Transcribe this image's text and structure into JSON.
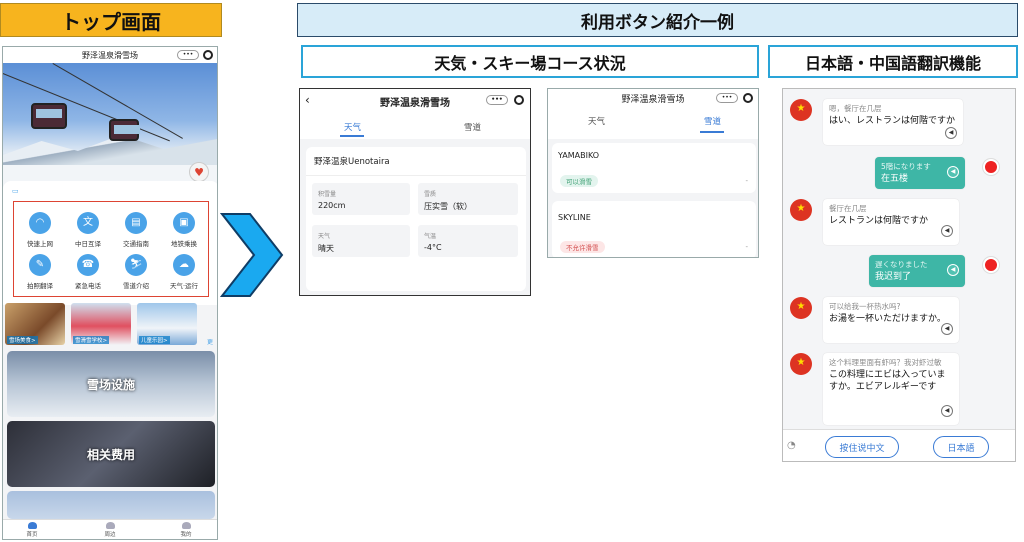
{
  "headers": {
    "top_screen": "トップ画面",
    "usage_examples": "利用ボタン紹介一例",
    "weather_course": "天気・スキー場コース状況",
    "translation": "日本語・中国語翻訳機能"
  },
  "colors": {
    "orange": "#f7b41e",
    "accent_blue": "#2aa4d8",
    "arrow_blue": "#1aa9f0",
    "icon_blue": "#4aa3e8",
    "chat_green": "#3eb6a6",
    "flag_red": "#d32f2f"
  },
  "home": {
    "app_title": "野泽温泉滑雪场",
    "capsule": "•••",
    "icons": [
      {
        "label": "快速上网",
        "icon": "wifi-icon"
      },
      {
        "label": "中日互译",
        "icon": "translate-icon"
      },
      {
        "label": "交通指南",
        "icon": "bus-icon"
      },
      {
        "label": "地铁乘换",
        "icon": "metro-icon"
      },
      {
        "label": "拍照翻译",
        "icon": "camera-translate-icon"
      },
      {
        "label": "紧急电话",
        "icon": "phone-icon"
      },
      {
        "label": "雪道介绍",
        "icon": "ski-icon"
      },
      {
        "label": "天气·运行",
        "icon": "weather-icon"
      }
    ],
    "thumbs": [
      "雪场美食>",
      "雪滑雪学校>",
      "儿童乐园>"
    ],
    "thumb_more": "更",
    "banners": [
      "雪场设施",
      "相关费用"
    ],
    "nav": [
      "首页",
      "周边",
      "我的"
    ]
  },
  "weather": {
    "app_title": "野泽温泉滑雪场",
    "tabs": [
      "天气",
      "雪道"
    ],
    "resort": "野泽温泉Uenotaira",
    "cells": [
      {
        "k": "积雪量",
        "v": "220cm"
      },
      {
        "k": "雪质",
        "v": "压实雪（软）"
      },
      {
        "k": "天气",
        "v": "晴天"
      },
      {
        "k": "气温",
        "v": "-4°C"
      }
    ]
  },
  "course": {
    "app_title": "野泽温泉滑雪场",
    "tabs": [
      "天气",
      "雪道"
    ],
    "items": [
      {
        "name": "YAMABIKO",
        "status": "可以滑雪"
      },
      {
        "name": "SKYLINE",
        "status": "不允许滑雪"
      }
    ]
  },
  "chat": {
    "messages": [
      {
        "src": "嗯，餐厅在几层",
        "dst": "はい、レストランは何階ですか"
      },
      {
        "src": "5階になります",
        "dst": "在五楼"
      },
      {
        "src": "餐厅在几层",
        "dst": "レストランは何階ですか"
      },
      {
        "src": "遅くなりました",
        "dst": "我迟到了"
      },
      {
        "src": "可以给我一杯热水吗?",
        "dst": "お湯を一杯いただけますか。"
      },
      {
        "src": "这个料理里面有虾吗？我对虾过敏",
        "dst": "この料理にエビは入っていますか。エビアレルギーです"
      }
    ],
    "btn_chinese": "按住说中文",
    "btn_japanese": "日本語"
  }
}
